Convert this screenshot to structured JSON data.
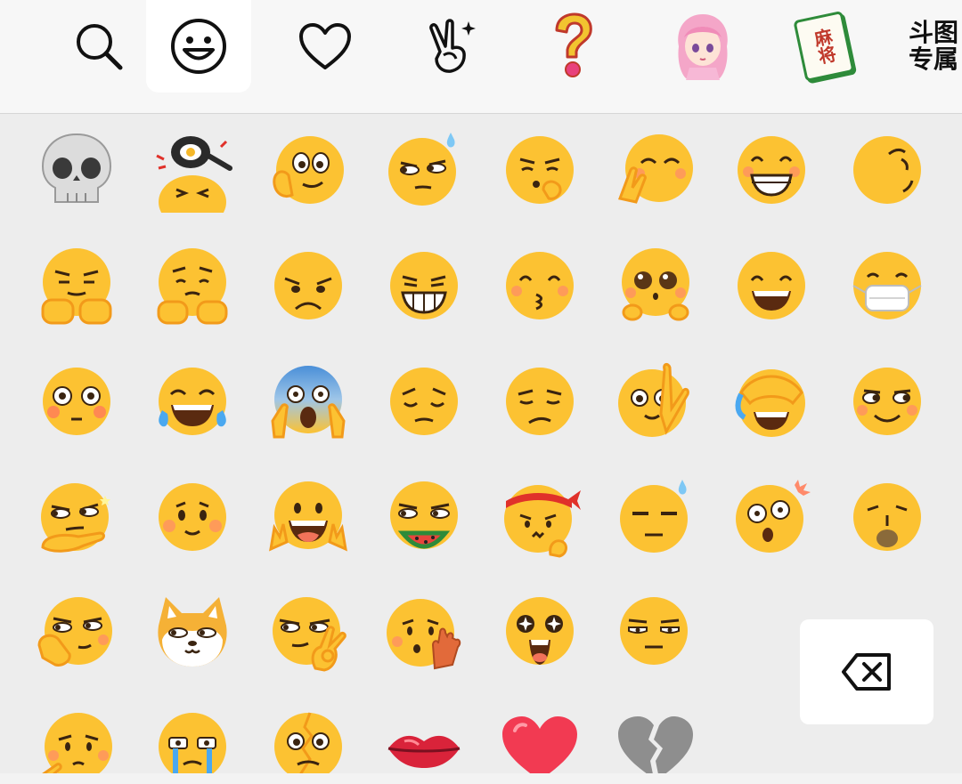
{
  "tabs": [
    {
      "name": "tab-search",
      "icon": "search-icon",
      "active": false
    },
    {
      "name": "tab-emoji",
      "icon": "smiley-icon",
      "active": true
    },
    {
      "name": "tab-favorites",
      "icon": "heart-icon",
      "active": false
    },
    {
      "name": "tab-gestures",
      "icon": "victory-hand-icon",
      "active": false
    },
    {
      "name": "tab-question",
      "icon": "question-mark-icon",
      "active": false
    },
    {
      "name": "tab-anime-girl",
      "icon": "anime-girl-icon",
      "active": false
    },
    {
      "name": "tab-mahjong",
      "icon": "mahjong-tile-icon",
      "active": false,
      "text": "麻将"
    },
    {
      "name": "tab-dou-zhuan",
      "icon": "text-sticker-icon",
      "active": false,
      "text": "斗图\n专属"
    }
  ],
  "emojis": [
    "skull",
    "frying-pan-on-head",
    "face-holding-cheek",
    "sweat-side-eye",
    "thinking-face",
    "hands-over-mouth-laughing",
    "blushing-grin",
    "smirking-looking-away",
    "smug-hands-under-chin",
    "pleading-hands-face",
    "sad-face",
    "big-grin-squint",
    "kissing-smile",
    "puppy-eyes",
    "beaming-smile",
    "face-with-mask",
    "flushed-face",
    "tears-of-joy",
    "screaming-in-fear",
    "pensive-face",
    "unamused-face",
    "hand-on-cheek-stare",
    "facepalm-laughing",
    "side-eye-smile",
    "smirk-with-hand",
    "smiling-blush",
    "excited-hands-up",
    "eating-watermelon",
    "fighting-headband",
    "sweat-expressionless",
    "shocked-face",
    "whistling-face",
    "thinking-smirk",
    "shiba-dog",
    "ok-hand-smirk",
    "shy-hand-wave",
    "starstruck-face",
    "expressionless-stare",
    "sad-sigh",
    "crying-teary",
    "broken-face",
    "red-lips",
    "red-heart",
    "broken-heart"
  ],
  "delete_key": {
    "icon": "backspace-icon"
  },
  "colors": {
    "face": "#fcc232",
    "face_shade": "#f29a1a",
    "dark": "#3a2410",
    "blush": "#ff8a6a",
    "heart": "#f23a52",
    "grey_heart": "#8e8e8e",
    "topbar_bg": "#f7f7f7",
    "grid_bg": "#ededed"
  }
}
